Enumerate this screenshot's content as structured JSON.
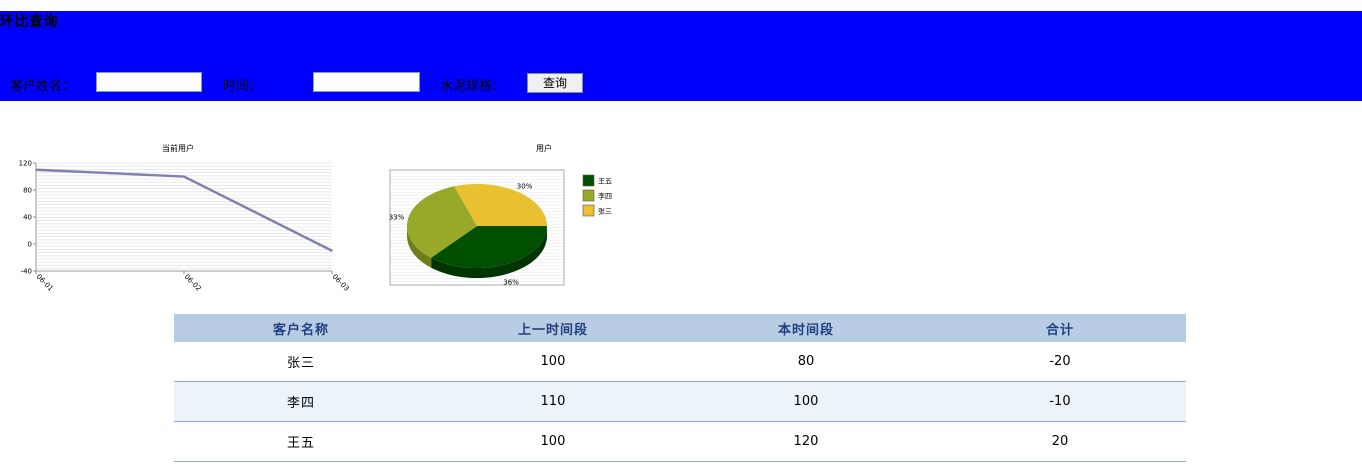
{
  "page": {
    "title": "环比查询"
  },
  "search": {
    "customer_label": "客户姓名：",
    "customer_value": "",
    "time_label": "时间：",
    "time_value": "",
    "spec_label": "水泥规格：",
    "query_button": "查询"
  },
  "colors": {
    "header_bg": "#0000ff",
    "table_header_bg": "#b8cce4",
    "table_header_text": "#1f3f7f",
    "row_alt_bg": "#ebf3fb",
    "line_series": "#8080b0",
    "pie_wang": "#005000",
    "pie_li": "#98a828",
    "pie_zhang": "#e8c030"
  },
  "chart_data": [
    {
      "type": "line",
      "title": "当前用户",
      "categories": [
        "06-01",
        "06-02",
        "06-03"
      ],
      "x": [
        "06-01",
        "06-02",
        "06-03"
      ],
      "series": [
        {
          "values": [
            110,
            100,
            -10
          ]
        }
      ],
      "ylim": [
        -40,
        120
      ],
      "yticks": [
        "120",
        "80",
        "40",
        "0",
        "-40"
      ],
      "grid": true
    },
    {
      "type": "pie",
      "title": "用户",
      "labels": [
        "王五",
        "李四",
        "张三"
      ],
      "values": [
        36,
        33,
        30
      ],
      "value_labels": [
        "36%",
        "33%",
        "30%"
      ],
      "legend": "right"
    }
  ],
  "table": {
    "headers": [
      "客户名称",
      "上一时间段",
      "本时间段",
      "合计"
    ],
    "rows": [
      [
        "张三",
        "100",
        "80",
        "-20"
      ],
      [
        "李四",
        "110",
        "100",
        "-10"
      ],
      [
        "王五",
        "100",
        "120",
        "20"
      ]
    ]
  }
}
